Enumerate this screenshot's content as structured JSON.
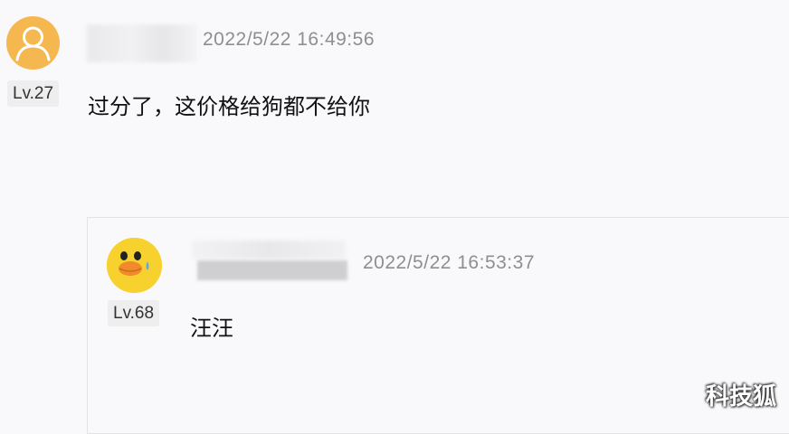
{
  "main_comment": {
    "avatar_icon": "default-user-icon",
    "level": "Lv.27",
    "timestamp": "2022/5/22 16:49:56",
    "text": "过分了，这价格给狗都不给你"
  },
  "reply": {
    "avatar_icon": "duck-avatar-icon",
    "level": "Lv.68",
    "timestamp": "2022/5/22 16:53:37",
    "text": "汪汪"
  },
  "watermark": "科技狐",
  "colors": {
    "background": "#f9f9fb",
    "avatar_orange": "#f5b850",
    "duck_yellow": "#f7d12e",
    "timestamp_gray": "#8e8e93"
  }
}
